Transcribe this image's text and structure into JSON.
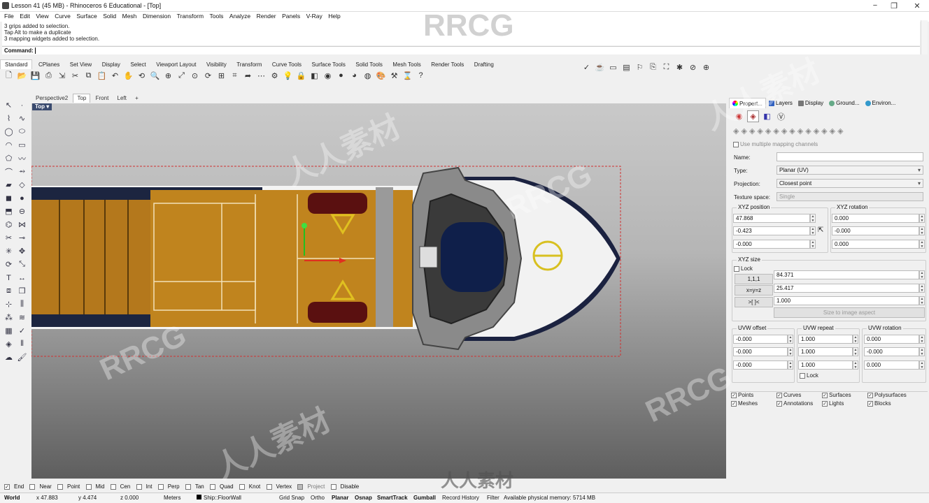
{
  "window": {
    "title": "Lesson 41 (45 MB) - Rhinoceros 6 Educational - [Top]"
  },
  "menu": [
    "File",
    "Edit",
    "View",
    "Curve",
    "Surface",
    "Solid",
    "Mesh",
    "Dimension",
    "Transform",
    "Tools",
    "Analyze",
    "Render",
    "Panels",
    "V-Ray",
    "Help"
  ],
  "command_history": [
    "3 grips added to selection.",
    "Tap Alt to make a duplicate",
    "3 mapping widgets added to selection."
  ],
  "command": {
    "label": "Command:"
  },
  "toolbar_tabs": [
    "Standard",
    "CPlanes",
    "Set View",
    "Display",
    "Select",
    "Viewport Layout",
    "Visibility",
    "Transform",
    "Curve Tools",
    "Surface Tools",
    "Solid Tools",
    "Mesh Tools",
    "Render Tools",
    "Drafting"
  ],
  "viewport_tabs": [
    "Perspective2",
    "Top",
    "Front",
    "Left",
    "+"
  ],
  "viewport": {
    "label": "Top"
  },
  "panel": {
    "tabs": [
      "Propert...",
      "Layers",
      "Display",
      "Ground...",
      "Environ..."
    ],
    "use_multiple": "Use multiple mapping channels",
    "name_label": "Name:",
    "name_value": "",
    "type_label": "Type:",
    "type_value": "Planar (UV)",
    "projection_label": "Projection:",
    "projection_value": "Closest point",
    "texture_space_label": "Texture space:",
    "texture_space_value": "Single",
    "xyz_position": {
      "title": "XYZ position",
      "values": [
        "47.868",
        "-0.423",
        "-0.000"
      ]
    },
    "xyz_rotation": {
      "title": "XYZ rotation",
      "values": [
        "0.000",
        "-0.000",
        "0.000"
      ]
    },
    "xyz_size": {
      "title": "XYZ size",
      "lock": "Lock",
      "labels": [
        "1,1,1",
        "x=y=z",
        ">[ ]<"
      ],
      "values": [
        "84.371",
        "25.417",
        "1.000"
      ],
      "button": "Size to image aspect"
    },
    "uvw_offset": {
      "title": "UVW offset",
      "values": [
        "-0.000",
        "-0.000",
        "-0.000"
      ]
    },
    "uvw_repeat": {
      "title": "UVW repeat",
      "values": [
        "1.000",
        "1.000",
        "1.000"
      ],
      "lock": "Lock"
    },
    "uvw_rotation": {
      "title": "UVW rotation",
      "values": [
        "0.000",
        "-0.000",
        "0.000"
      ]
    },
    "filters": [
      "Points",
      "Curves",
      "Surfaces",
      "Polysurfaces",
      "Meshes",
      "Annotations",
      "Lights",
      "Blocks"
    ]
  },
  "osnap": {
    "items": [
      "End",
      "Near",
      "Point",
      "Mid",
      "Cen",
      "Int",
      "Perp",
      "Tan",
      "Quad",
      "Knot",
      "Vertex",
      "Project",
      "Disable"
    ],
    "checked": [
      "End"
    ]
  },
  "status": {
    "cplane": "World",
    "x": "x 47.883",
    "y": "y 4.474",
    "z": "z 0.000",
    "units": "Meters",
    "layer": "Ship::FloorWall",
    "toggles": [
      "Grid Snap",
      "Ortho",
      "Planar",
      "Osnap",
      "SmartTrack",
      "Gumball",
      "Record History",
      "Filter"
    ],
    "memory": "Available physical memory: 5714 MB"
  },
  "watermarks": [
    "RRCG",
    "人人素材"
  ]
}
